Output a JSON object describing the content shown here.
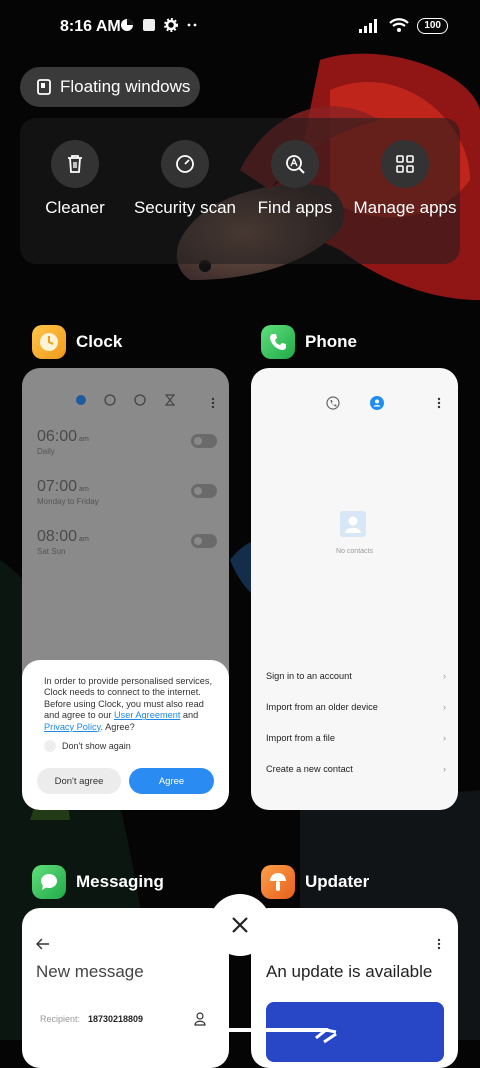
{
  "status_bar": {
    "time": "8:16 AM",
    "battery": "100",
    "icons_left": [
      "data-saver-icon",
      "square-icon",
      "gear-icon",
      "more-dots-icon"
    ],
    "icons_right": [
      "signal-icon",
      "wifi-icon",
      "battery-icon"
    ]
  },
  "floating_windows": {
    "label": "Floating windows",
    "icon": "window-icon"
  },
  "quick_actions": [
    {
      "label": "Cleaner",
      "icon": "trash-icon"
    },
    {
      "label": "Security scan",
      "icon": "security-scan-icon"
    },
    {
      "label": "Find apps",
      "icon": "find-apps-icon"
    },
    {
      "label": "Manage apps",
      "icon": "grid-icon"
    }
  ],
  "recent_apps": {
    "clock": {
      "name": "Clock",
      "alarms": [
        {
          "time": "06:00",
          "ampm": "am",
          "repeat": "Daily"
        },
        {
          "time": "07:00",
          "ampm": "am",
          "repeat": "Monday to Friday"
        },
        {
          "time": "08:00",
          "ampm": "am",
          "repeat": "Sat Sun"
        }
      ],
      "dialog": {
        "text_1": "In order to provide personalised services, Clock needs to connect to the internet. Before using Clock, you must also read and agree to our ",
        "link_user_agreement": "User Agreement",
        "text_and": " and ",
        "link_privacy": "Privacy Policy",
        "text_2": ". Agree?",
        "dont_show": "Don't show again",
        "disagree": "Don't agree",
        "agree": "Agree"
      }
    },
    "phone": {
      "name": "Phone",
      "empty_text": "No contacts",
      "items": [
        "Sign in to an account",
        "Import from an older device",
        "Import from a file",
        "Create a new contact"
      ]
    },
    "messaging": {
      "name": "Messaging",
      "title": "New message",
      "recipient_label": "Recipient:",
      "recipient_value": "18730218809"
    },
    "updater": {
      "name": "Updater",
      "title": "An update is available"
    }
  },
  "colors": {
    "accent": "#2a8cf2",
    "panel": "#3a3a3a",
    "clock_icon": "#f5a623",
    "phone_icon": "#34c759",
    "messaging_icon": "#34c759",
    "updater_icon": "#f07a2e"
  }
}
